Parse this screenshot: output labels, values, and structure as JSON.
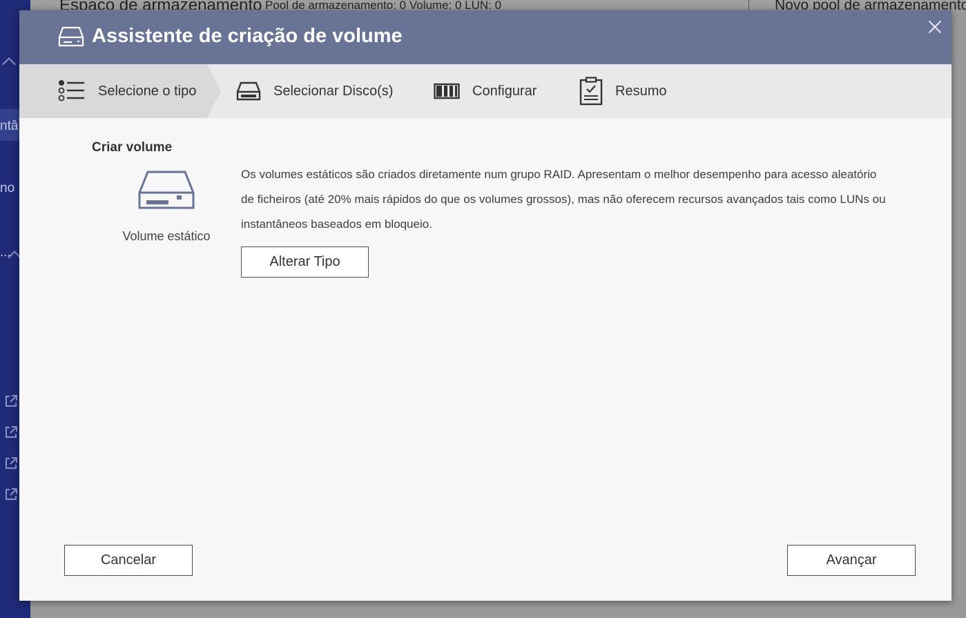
{
  "background": {
    "header_title": "Espaço de armazenamento",
    "header_stats": "Pool de armazenamento: 0   Volume: 0   LUN: 0",
    "header_right": "Novo pool de armazenamento",
    "sidebar_fragments": [
      "ntâ",
      "no",
      "..."
    ]
  },
  "dialog": {
    "title": "Assistente de criação de volume",
    "steps": [
      {
        "label": "Selecione o tipo",
        "icon": "list-icon",
        "active": true
      },
      {
        "label": "Selecionar Disco(s)",
        "icon": "disk-icon",
        "active": false
      },
      {
        "label": "Configurar",
        "icon": "configure-icon",
        "active": false
      },
      {
        "label": "Resumo",
        "icon": "clipboard-icon",
        "active": false
      }
    ],
    "section_title": "Criar volume",
    "volume_type": "Volume estático",
    "description": "Os volumes estáticos são criados diretamente num grupo RAID. Apresentam o melhor desempenho para acesso aleatório de ficheiros (até 20% mais rápidos do que os volumes grossos), mas não oferecem recursos avançados tais como LUNs ou instantâneos baseados em bloqueio.",
    "change_type_button": "Alterar Tipo",
    "cancel_button": "Cancelar",
    "next_button": "Avançar"
  },
  "colors": {
    "titlebar": "#687395",
    "sidebar": "#1f2a78",
    "steps_bar": "#e9e9e9",
    "active_step": "#d9d9d9"
  }
}
